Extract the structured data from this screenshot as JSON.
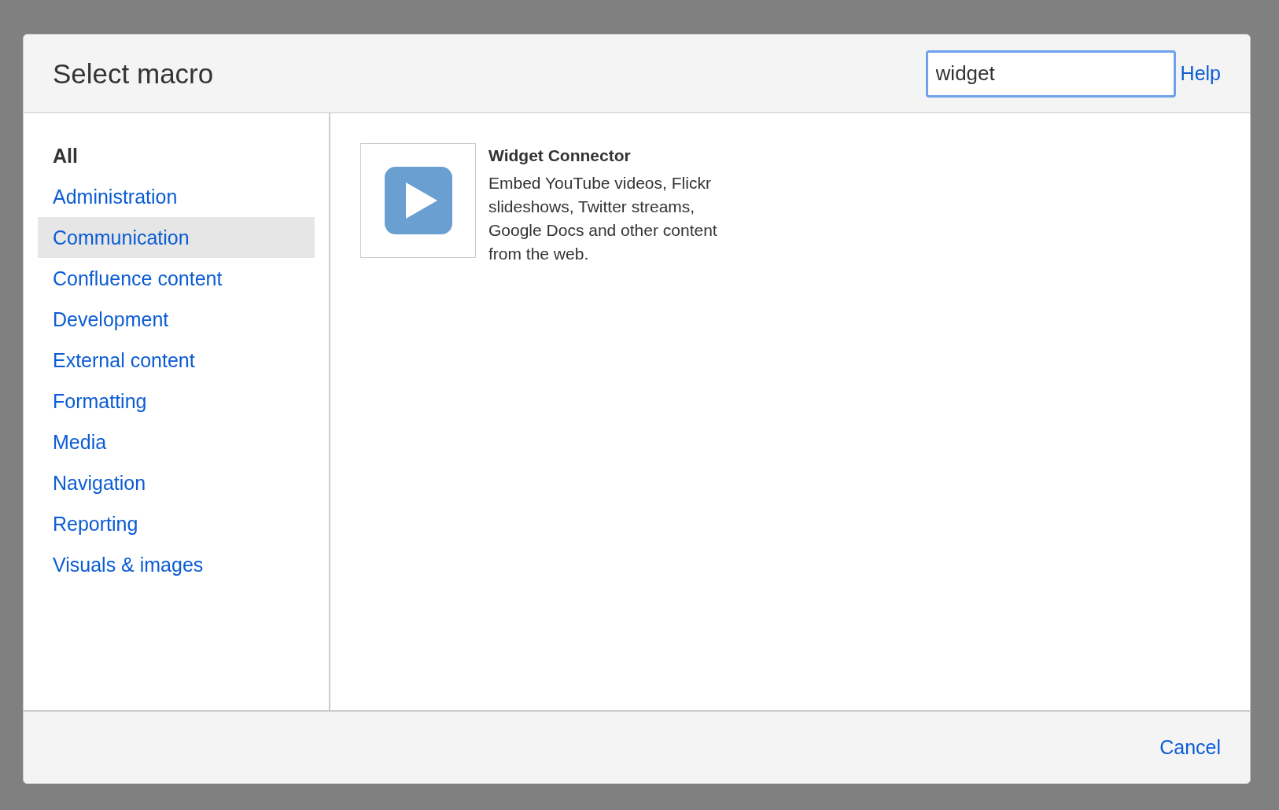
{
  "dialog": {
    "title": "Select macro",
    "search": {
      "value": "widget"
    },
    "help_link": "Help"
  },
  "categories": [
    {
      "label": "All",
      "selected": true,
      "highlighted": false
    },
    {
      "label": "Administration",
      "selected": false,
      "highlighted": false
    },
    {
      "label": "Communication",
      "selected": false,
      "highlighted": true
    },
    {
      "label": "Confluence content",
      "selected": false,
      "highlighted": false
    },
    {
      "label": "Development",
      "selected": false,
      "highlighted": false
    },
    {
      "label": "External content",
      "selected": false,
      "highlighted": false
    },
    {
      "label": "Formatting",
      "selected": false,
      "highlighted": false
    },
    {
      "label": "Media",
      "selected": false,
      "highlighted": false
    },
    {
      "label": "Navigation",
      "selected": false,
      "highlighted": false
    },
    {
      "label": "Reporting",
      "selected": false,
      "highlighted": false
    },
    {
      "label": "Visuals & images",
      "selected": false,
      "highlighted": false
    }
  ],
  "macros": [
    {
      "name": "Widget Connector",
      "description": "Embed YouTube videos, Flickr slideshows, Twitter streams, Google Docs and other content from the web."
    }
  ],
  "footer": {
    "cancel": "Cancel"
  }
}
